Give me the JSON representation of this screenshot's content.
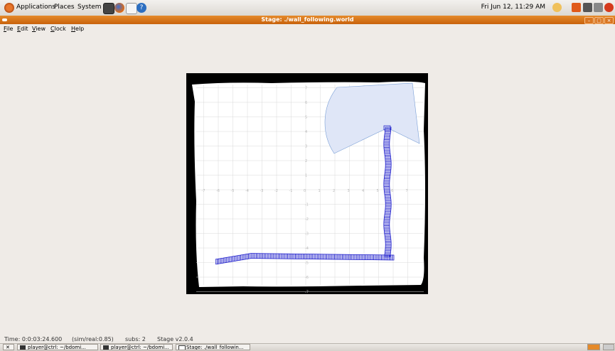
{
  "top_panel": {
    "menus": [
      "Applications",
      "Places",
      "System"
    ],
    "clock": "Fri Jun 12, 11:29 AM"
  },
  "window": {
    "title": "Stage: ./wall_following.world",
    "menus": [
      "File",
      "Edit",
      "View",
      "Clock",
      "Help"
    ]
  },
  "status": {
    "time": "Time: 0:0:03:24.600",
    "ratio": "(sim/real:0.85)",
    "subs": "subs: 2",
    "version": "Stage v2.0.4"
  },
  "taskbar": {
    "tasks": [
      "player@ctrl: ~/bdomi...",
      "player@ctrl: ~/bdomi...",
      "Stage: ./wall_followin..."
    ]
  },
  "map": {
    "x_ticks": [
      "-7",
      "-6",
      "-5",
      "-4",
      "-3",
      "-2",
      "-1",
      "0",
      "1",
      "2",
      "3",
      "4",
      "5",
      "6",
      "7"
    ],
    "y_ticks": [
      "7",
      "6",
      "5",
      "4",
      "3",
      "2",
      "1",
      "-1",
      "-2",
      "-3",
      "-4",
      "-5",
      "-6",
      "-7"
    ],
    "colors": {
      "robot": "#1010c8",
      "laser": "#dfe6f7",
      "laser_edge": "#7a9fd6",
      "grid": "#d8d8d8"
    }
  }
}
